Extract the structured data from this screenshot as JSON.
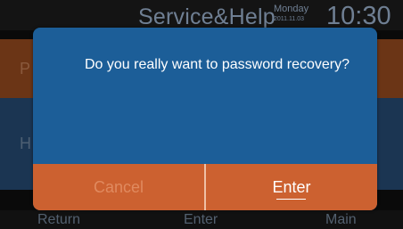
{
  "header": {
    "title": "Service&Help",
    "day": "Monday",
    "date": "2011.11.03",
    "time": "10:30"
  },
  "background_menu": {
    "items": [
      {
        "label": "P"
      },
      {
        "label": "H"
      }
    ]
  },
  "dialog": {
    "message": "Do you really want to password recovery?",
    "cancel_label": "Cancel",
    "enter_label": "Enter"
  },
  "footer": {
    "return_label": "Return",
    "enter_label": "Enter",
    "main_label": "Main"
  },
  "colors": {
    "dialog_background": "#1c5e98",
    "button_bar": "#cc6130",
    "disabled_text": "#e08a5f",
    "header_text": "#6f7f93"
  }
}
